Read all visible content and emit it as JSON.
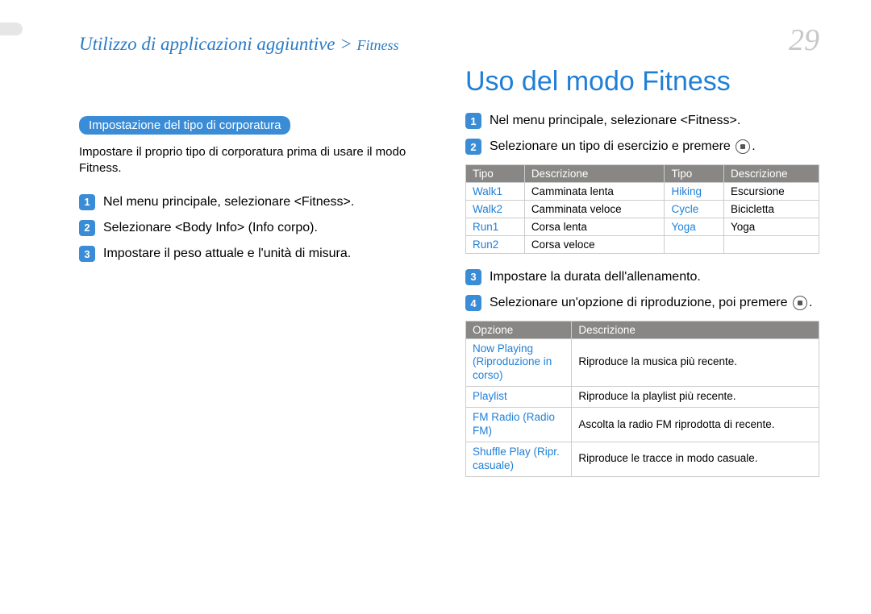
{
  "header": {
    "breadcrumb_main": "Utilizzo di applicazioni aggiuntive > ",
    "breadcrumb_sub": "Fitness",
    "page_number": "29"
  },
  "left": {
    "pill": "Impostazione del tipo di corporatura",
    "intro": "Impostare il proprio tipo di corporatura prima di usare il modo Fitness.",
    "steps": [
      "Nel menu principale, selezionare <Fitness>.",
      "Selezionare <Body Info> (Info corpo).",
      "Impostare il peso attuale e l'unità di misura."
    ]
  },
  "right": {
    "heading": "Uso del modo Fitness",
    "steps12": {
      "s1": "Nel menu principale, selezionare <Fitness>.",
      "s2_pre": "Selezionare un tipo di esercizio e premere ",
      "s2_post": "."
    },
    "exercise_table": {
      "th_type": "Tipo",
      "th_desc": "Descrizione",
      "rows": [
        {
          "t1": "Walk1",
          "d1": "Camminata lenta",
          "t2": "Hiking",
          "d2": "Escursione"
        },
        {
          "t1": "Walk2",
          "d1": "Camminata veloce",
          "t2": "Cycle",
          "d2": "Bicicletta"
        },
        {
          "t1": "Run1",
          "d1": "Corsa lenta",
          "t2": "Yoga",
          "d2": "Yoga"
        },
        {
          "t1": "Run2",
          "d1": "Corsa veloce",
          "t2": "",
          "d2": ""
        }
      ]
    },
    "steps34": {
      "s3": "Impostare la durata dell'allenamento.",
      "s4_pre": "Selezionare un'opzione di riproduzione, poi premere ",
      "s4_post": "."
    },
    "options_table": {
      "th_option": "Opzione",
      "th_desc": "Descrizione",
      "rows": [
        {
          "opt": "Now Playing (Riproduzione in corso)",
          "desc": "Riproduce la musica più recente."
        },
        {
          "opt": "Playlist",
          "desc": "Riproduce la playlist più recente."
        },
        {
          "opt": "FM Radio (Radio FM)",
          "desc": "Ascolta la radio FM riprodotta di recente."
        },
        {
          "opt": "Shuffle Play (Ripr. casuale)",
          "desc": "Riproduce le tracce in modo casuale."
        }
      ]
    }
  }
}
